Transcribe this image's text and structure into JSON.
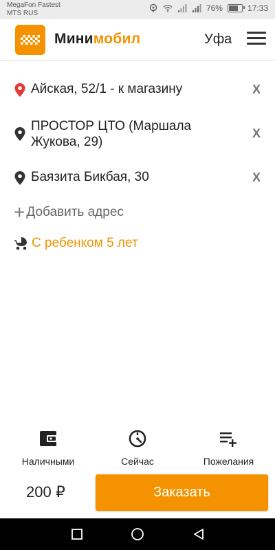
{
  "status_bar": {
    "carrier_line1": "MegaFon Fastest",
    "carrier_line2": "MTS RUS",
    "battery_percent": "76%",
    "battery_level": 0.76,
    "time": "17:33"
  },
  "header": {
    "brand_part1": "Мини",
    "brand_part2": "мобил",
    "city": "Уфа"
  },
  "addresses": [
    {
      "text": "Айская, 52/1 - к магазину",
      "pin_color": "#e53935",
      "remove_label": "X"
    },
    {
      "text": "ПРОСТОР ЦТО (Маршала Жукова, 29)",
      "pin_color": "#333333",
      "remove_label": "X"
    },
    {
      "text": "Баязита Бикбая, 30",
      "pin_color": "#333333",
      "remove_label": "X"
    }
  ],
  "add_address": {
    "label": "Добавить адрес"
  },
  "child_option": {
    "label": "С ребенком 5 лет"
  },
  "options": {
    "payment": {
      "label": "Наличными",
      "icon": "wallet-icon"
    },
    "time": {
      "label": "Сейчас",
      "icon": "timer-icon"
    },
    "wishes": {
      "label": "Пожелания",
      "icon": "playlist-add-icon"
    }
  },
  "footer": {
    "price": "200 ₽",
    "order_label": "Заказать"
  },
  "colors": {
    "accent": "#f49200",
    "pin_active": "#e53935"
  }
}
